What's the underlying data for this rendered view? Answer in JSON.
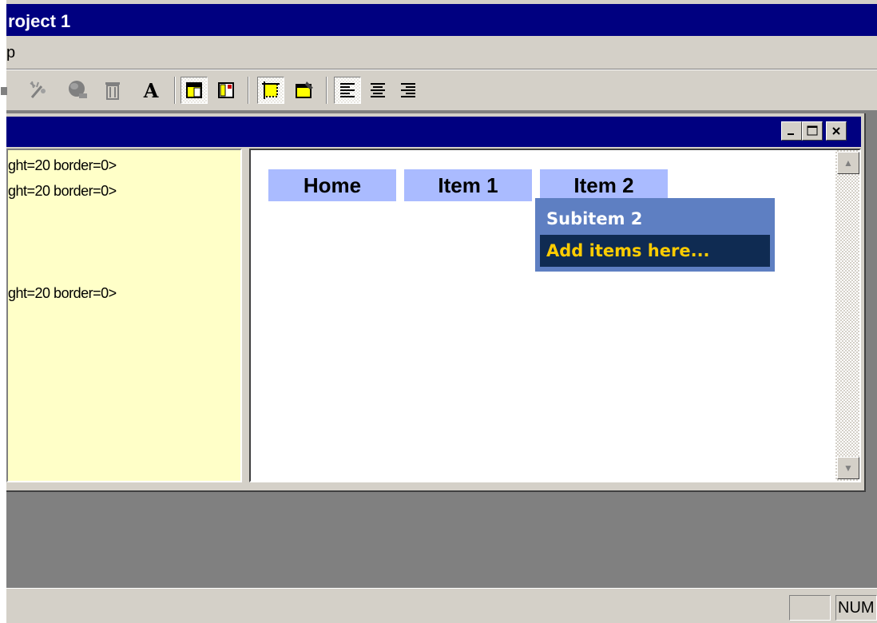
{
  "app": {
    "title": "roject 1"
  },
  "menubar": {
    "first_item": "p"
  },
  "code_pane": {
    "lines": [
      "ght=20 border=0>",
      "ght=20 border=0>",
      "ght=20 border=0>"
    ]
  },
  "preview_menu": {
    "items": [
      "Home",
      "Item 1",
      "Item 2"
    ],
    "submenu": {
      "items": [
        "Subitem 2",
        "Add items here..."
      ]
    },
    "colors": {
      "item_bg": "#aabbff",
      "submenu_bg": "#5e7fc2",
      "selected_bg": "#0f2b52",
      "selected_text": "#ffcc00"
    }
  },
  "statusbar": {
    "indicator": "NUM"
  },
  "colors": {
    "titlebar": "#000080",
    "chrome": "#d4d0c8",
    "code_bg": "#ffffc8"
  },
  "icons": [
    "cursor-icon",
    "magic-wand-icon",
    "globe-icon",
    "trash-icon",
    "text-icon",
    "insert-top-icon",
    "insert-item-icon",
    "frame-icon",
    "properties-icon",
    "align-left-icon",
    "align-center-icon",
    "align-right-icon",
    "minimize-icon",
    "maximize-icon",
    "close-icon",
    "scroll-up-icon",
    "scroll-down-icon"
  ]
}
